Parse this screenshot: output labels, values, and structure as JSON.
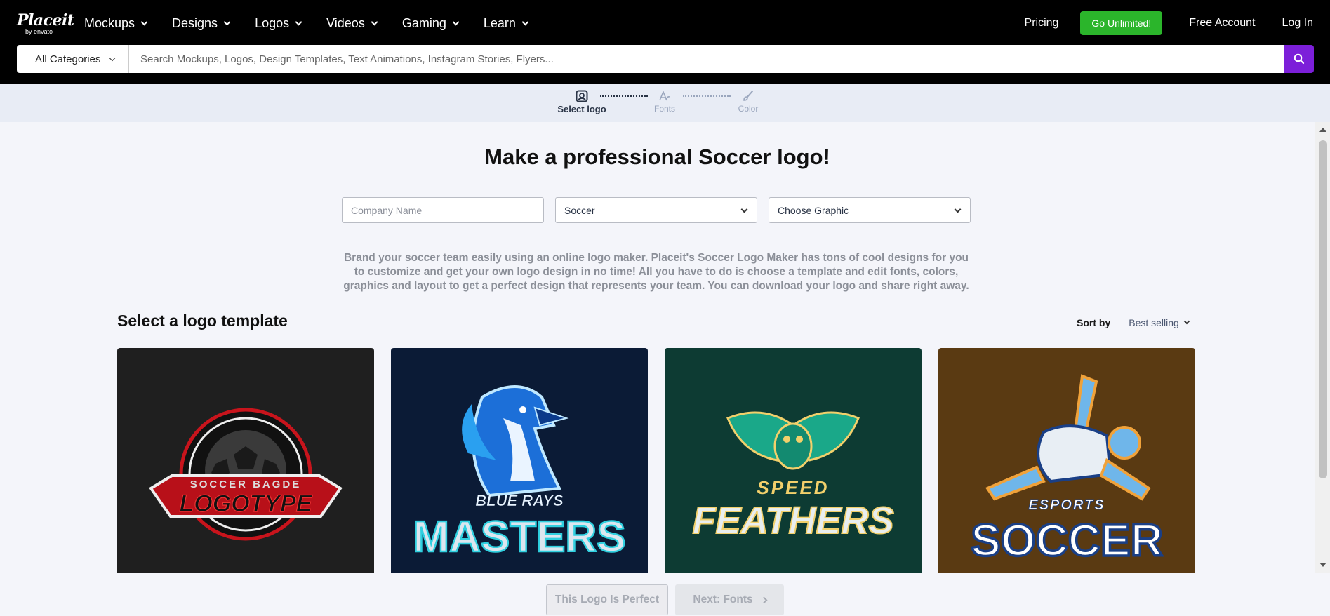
{
  "nav": {
    "logo_brand": "Placeit",
    "logo_by": "by envato",
    "menu": [
      {
        "label": "Mockups"
      },
      {
        "label": "Designs"
      },
      {
        "label": "Logos"
      },
      {
        "label": "Videos"
      },
      {
        "label": "Gaming"
      },
      {
        "label": "Learn"
      }
    ],
    "pricing": "Pricing",
    "unlimited": "Go Unlimited!",
    "free_account": "Free Account",
    "login": "Log In",
    "unlimited_color": "#2bb52b"
  },
  "search": {
    "category": "All Categories",
    "placeholder": "Search Mockups, Logos, Design Templates, Text Animations, Instagram Stories, Flyers...",
    "button_color": "#7c1fd9"
  },
  "stepper": {
    "steps": [
      {
        "label": "Select logo",
        "state": "active"
      },
      {
        "label": "Fonts",
        "state": "inactive"
      },
      {
        "label": "Color",
        "state": "inactive"
      }
    ]
  },
  "main": {
    "headline": "Make a professional Soccer logo!",
    "company_placeholder": "Company Name",
    "industry_value": "Soccer",
    "graphic_value": "Choose Graphic",
    "description": "Brand your soccer team easily using an online logo maker. Placeit's Soccer Logo Maker has tons of cool designs for you to customize and get your own logo design in no time! All you have to do is choose a template and edit fonts, colors, graphics and layout to get a perfect design that represents your team. You can download your logo and share right away.",
    "section_title": "Select a logo template",
    "sort_label": "Sort by",
    "sort_value": "Best selling"
  },
  "cards": [
    {
      "bg": "#1f1f1f",
      "top_text": "SOCCER BAGDE",
      "main_text": "LOGOTYPE"
    },
    {
      "bg": "#0b1b36",
      "top_text": "BLUE RAYS",
      "main_text": "MASTERS"
    },
    {
      "bg": "#0d3b33",
      "top_text": "SPEED",
      "main_text": "FEATHERS"
    },
    {
      "bg": "#5a3a12",
      "top_text": "ESPORTS",
      "main_text": "SOCCER"
    }
  ],
  "footer": {
    "perfect_label": "This Logo Is Perfect",
    "next_label": "Next: Fonts"
  }
}
